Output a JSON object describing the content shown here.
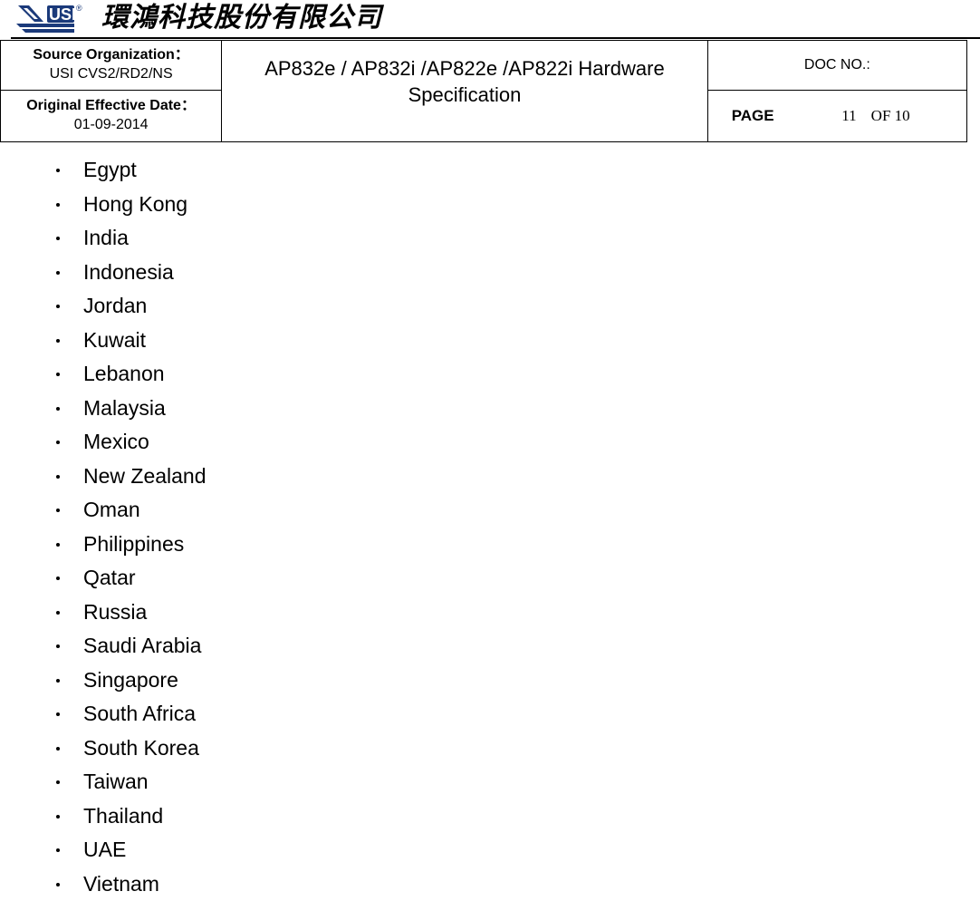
{
  "logo": {
    "brand": "USI",
    "registered": "®",
    "company_name_cn": "環鴻科技股份有限公司",
    "brand_color": "#1b3a7a"
  },
  "header": {
    "source_org_label": "Source Organization：",
    "source_org_value": "USI CVS2/RD2/NS",
    "effective_date_label": "Original Effective Date：",
    "effective_date_value": "01-09-2014",
    "title": "AP832e / AP832i /AP822e /AP822i Hardware Specification",
    "doc_no_label": "DOC NO.:",
    "page_label": "PAGE",
    "page_current": "11",
    "page_of": "OF 10"
  },
  "countries": [
    "Egypt",
    "Hong Kong",
    "India",
    "Indonesia",
    "Jordan",
    "Kuwait",
    "Lebanon",
    "Malaysia",
    "Mexico",
    "New Zealand",
    "Oman",
    "Philippines",
    "Qatar",
    "Russia",
    "Saudi Arabia",
    "Singapore",
    "South Africa",
    "South Korea",
    "Taiwan",
    "Thailand",
    "UAE",
    "Vietnam"
  ]
}
